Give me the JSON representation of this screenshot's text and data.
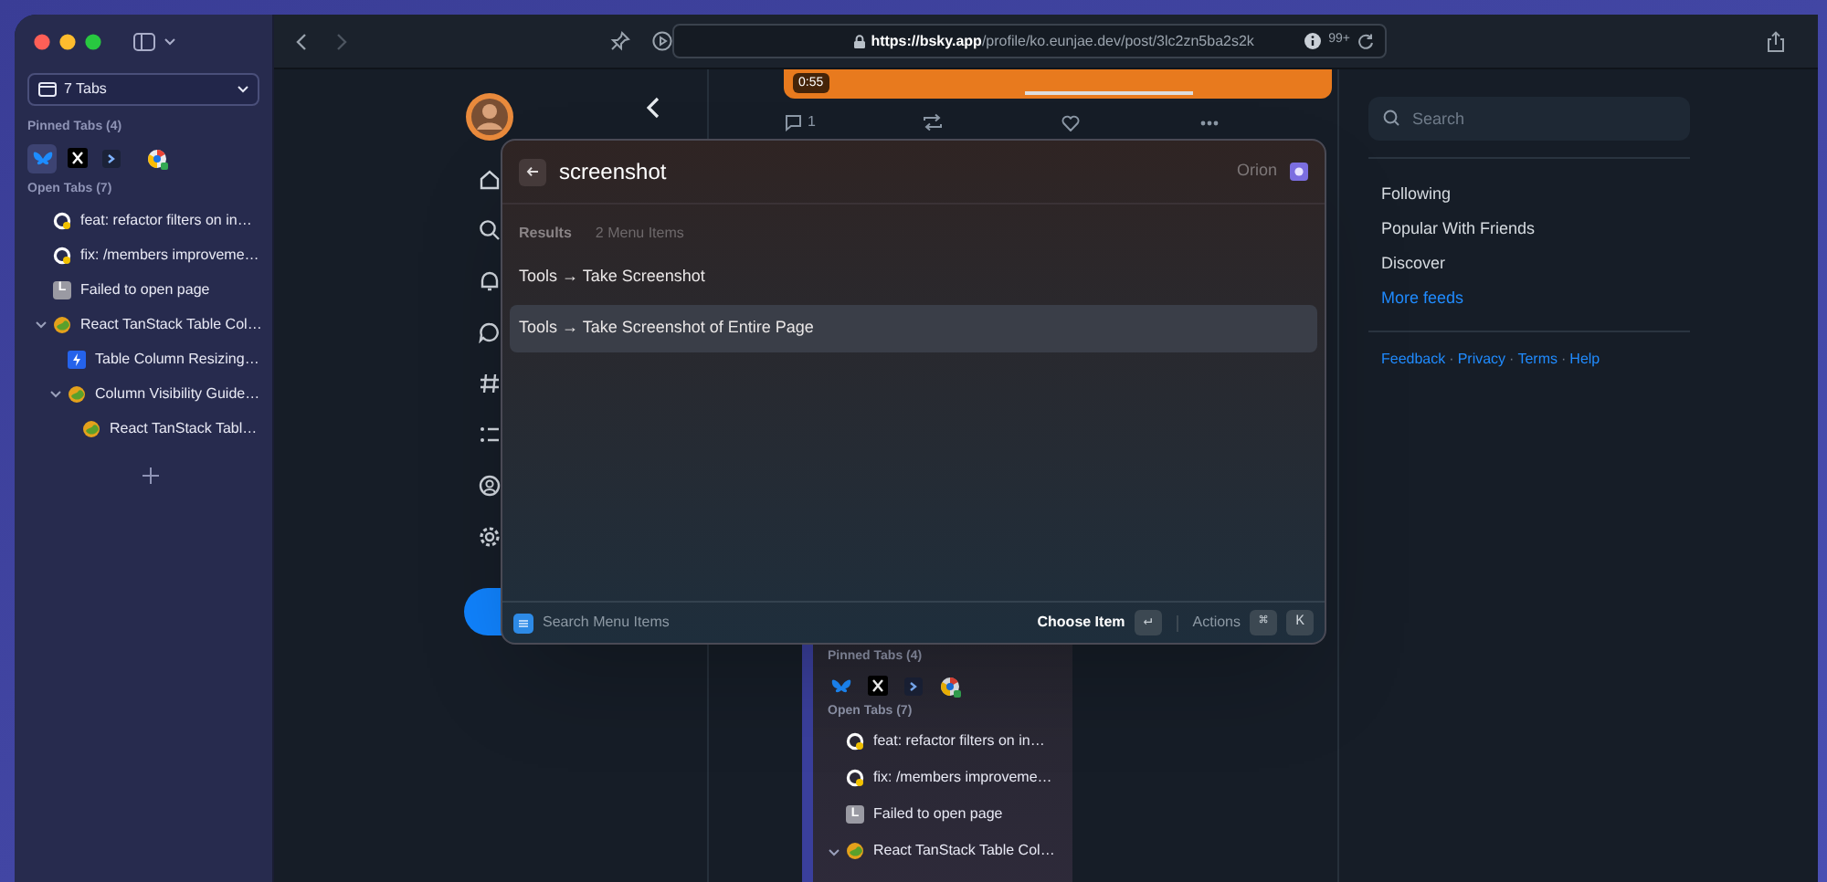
{
  "sidebar": {
    "tab_selector": "7 Tabs",
    "pinned_label": "Pinned Tabs (4)",
    "pinned": [
      {
        "kind": "butterfly",
        "selected": true
      },
      {
        "kind": "x",
        "selected": false
      },
      {
        "kind": "prompt",
        "selected": false
      },
      {
        "kind": "chrome",
        "selected": false
      }
    ],
    "open_label": "Open Tabs (7)",
    "tabs": [
      {
        "title": "feat: refactor filters on in…",
        "kind": "github"
      },
      {
        "title": "fix: /members improveme…",
        "kind": "github"
      },
      {
        "title": "Failed to open page",
        "kind": "letter",
        "badge": "L"
      },
      {
        "title": "React TanStack Table Col…",
        "kind": "globe",
        "expanded": true,
        "children": [
          {
            "title": "Table Column Resizing…",
            "kind": "bolt"
          },
          {
            "title": "Column Visibility Guide…",
            "kind": "globe",
            "expanded": true,
            "children": [
              {
                "title": "React TanStack Tabl…",
                "kind": "globe"
              }
            ]
          }
        ]
      }
    ]
  },
  "toolbar": {
    "url_host": "https://bsky.app",
    "url_path": "/profile/ko.eunjae.dev/post/3lc2zn5ba2s2k",
    "badge": "99+"
  },
  "post": {
    "video_time": "0:55",
    "reply_count": "1"
  },
  "post_screenshot": {
    "pinned_label": "Pinned Tabs (4)",
    "pinned": [
      {
        "kind": "butterfly"
      },
      {
        "kind": "x"
      },
      {
        "kind": "prompt"
      },
      {
        "kind": "chrome"
      }
    ],
    "open_label": "Open Tabs (7)",
    "tabs": [
      {
        "title": "feat: refactor filters on in…",
        "kind": "github"
      },
      {
        "title": "fix: /members improveme…",
        "kind": "github"
      },
      {
        "title": "Failed to open page",
        "kind": "letter",
        "badge": "L"
      },
      {
        "title": "React TanStack Table Col…",
        "kind": "globe",
        "expanded": true
      }
    ]
  },
  "right_column": {
    "search": {
      "placeholder": "Search"
    },
    "feeds": [
      "Following",
      "Popular With Friends",
      "Discover"
    ],
    "more_feeds": "More feeds",
    "footer": [
      {
        "kind": "link",
        "text": "Feedback"
      },
      {
        "kind": "separator",
        "text": "·"
      },
      {
        "kind": "link",
        "text": "Privacy"
      },
      {
        "kind": "separator",
        "text": "·"
      },
      {
        "kind": "link",
        "text": "Terms"
      },
      {
        "kind": "separator",
        "text": "·"
      },
      {
        "kind": "link",
        "text": "Help"
      }
    ]
  },
  "palette": {
    "query": "screenshot",
    "scope": "Orion",
    "results_label": "Results",
    "results_count": "2 Menu Items",
    "items": [
      {
        "label": "Tools → Take Screenshot",
        "selected": false
      },
      {
        "label": "Tools → Take Screenshot of Entire Page",
        "selected": true
      }
    ],
    "footer": {
      "source": "Search Menu Items",
      "primary": "Choose Item",
      "primary_key": "↵",
      "actions": "Actions",
      "keys": [
        "⌘",
        "K"
      ]
    }
  }
}
